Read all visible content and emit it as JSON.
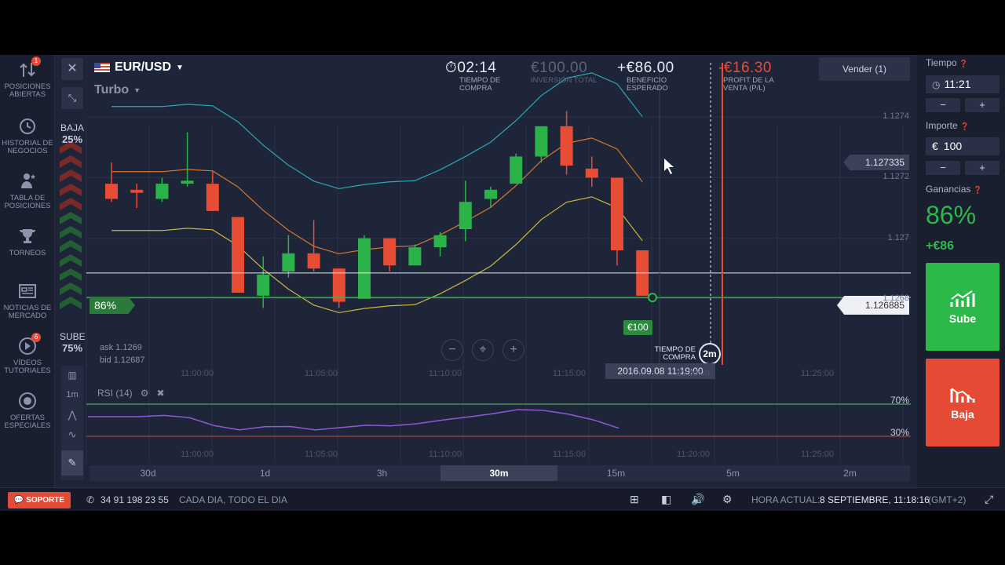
{
  "sidebar": {
    "items": [
      {
        "label_l1": "POSICIONES",
        "label_l2": "ABIERTAS",
        "icon": "positions-icon",
        "badge": "1"
      },
      {
        "label_l1": "HISTORIAL DE",
        "label_l2": "NEGOCIOS",
        "icon": "history-icon"
      },
      {
        "label_l1": "TABLA DE",
        "label_l2": "POSICIONES",
        "icon": "leaderboard-icon"
      },
      {
        "label_l1": "TORNEOS",
        "label_l2": "",
        "icon": "trophy-icon"
      },
      {
        "label_l1": "NOTICIAS DE",
        "label_l2": "MERCADO",
        "icon": "news-icon"
      },
      {
        "label_l1": "VÍDEOS",
        "label_l2": "TUTORIALES",
        "icon": "video-icon",
        "badge": "6"
      },
      {
        "label_l1": "OFERTAS",
        "label_l2": "ESPECIALES",
        "icon": "offers-icon"
      }
    ]
  },
  "header": {
    "pair": "EUR/USD",
    "mode": "Turbo",
    "timer": {
      "value": "02:14",
      "label_l1": "TIEMPO DE",
      "label_l2": "COMPRA"
    },
    "investment": {
      "value": "€100.00",
      "label": "INVERSIÓN TOTAL"
    },
    "profit": {
      "value": "+€86.00",
      "label_l1": "BENEFICIO",
      "label_l2": "ESPERADO"
    },
    "pl": {
      "value": "-€16.30",
      "label_l1": "PROFIT DE LA",
      "label_l2": "VENTA (P/L)"
    },
    "sell_button": "Vender (1)"
  },
  "sentiment": {
    "down_label": "BAJA",
    "down_pct": "25%",
    "up_label": "SUBE",
    "up_pct": "75%"
  },
  "chart": {
    "payout_tag": "86%",
    "price_tag_top": "1.127335",
    "price_tag_current": "1.126885",
    "price_levels": [
      "1.1274",
      "1.1272",
      "1.127",
      "1.1268"
    ],
    "ask": "ask 1.1269",
    "bid": "bid 1.12687",
    "bet_tag": "€100",
    "expiry_label_l1": "TIEMPO DE",
    "expiry_label_l2": "COMPRA",
    "expiry_badge": "2m",
    "cursor_time": "2016.09.08 11:19:00",
    "time_ticks": [
      "11:00:00",
      "11:05:00",
      "11:10:00",
      "11:15:00",
      "11:20:00",
      "11:25:00"
    ],
    "indicator": "RSI (14)",
    "rsi_levels": [
      "70%",
      "30%"
    ],
    "timeframes": [
      "30d",
      "1d",
      "3h",
      "30m",
      "15m",
      "5m",
      "2m"
    ],
    "active_timeframe": "30m",
    "candle_interval": "1m"
  },
  "chart_data": {
    "type": "candlestick",
    "x_axis": [
      "11:00:00",
      "11:05:00",
      "11:10:00",
      "11:15:00",
      "11:20:00",
      "11:25:00"
    ],
    "y_axis_ticks": [
      1.1274,
      1.1272,
      1.127,
      1.1268
    ],
    "candles": [
      {
        "o": 1.12718,
        "c": 1.12713,
        "h": 1.12725,
        "l": 1.12712,
        "dir": "down"
      },
      {
        "o": 1.12716,
        "c": 1.12715,
        "h": 1.12718,
        "l": 1.1271,
        "dir": "down"
      },
      {
        "o": 1.12713,
        "c": 1.12718,
        "h": 1.1272,
        "l": 1.12712,
        "dir": "up"
      },
      {
        "o": 1.12718,
        "c": 1.12719,
        "h": 1.12735,
        "l": 1.12717,
        "dir": "up"
      },
      {
        "o": 1.12718,
        "c": 1.12709,
        "h": 1.12722,
        "l": 1.12709,
        "dir": "down"
      },
      {
        "o": 1.12707,
        "c": 1.12682,
        "h": 1.12707,
        "l": 1.12682,
        "dir": "down"
      },
      {
        "o": 1.12681,
        "c": 1.12688,
        "h": 1.12694,
        "l": 1.12677,
        "dir": "up"
      },
      {
        "o": 1.12689,
        "c": 1.12695,
        "h": 1.12701,
        "l": 1.12687,
        "dir": "up"
      },
      {
        "o": 1.12695,
        "c": 1.1269,
        "h": 1.12706,
        "l": 1.12689,
        "dir": "down"
      },
      {
        "o": 1.1269,
        "c": 1.12679,
        "h": 1.1269,
        "l": 1.12677,
        "dir": "down"
      },
      {
        "o": 1.1268,
        "c": 1.127,
        "h": 1.12701,
        "l": 1.1268,
        "dir": "up"
      },
      {
        "o": 1.127,
        "c": 1.12691,
        "h": 1.127,
        "l": 1.12689,
        "dir": "down"
      },
      {
        "o": 1.12691,
        "c": 1.12697,
        "h": 1.12698,
        "l": 1.12691,
        "dir": "up"
      },
      {
        "o": 1.12697,
        "c": 1.12701,
        "h": 1.12702,
        "l": 1.12694,
        "dir": "up"
      },
      {
        "o": 1.12703,
        "c": 1.12712,
        "h": 1.12719,
        "l": 1.12699,
        "dir": "up"
      },
      {
        "o": 1.12713,
        "c": 1.12716,
        "h": 1.12717,
        "l": 1.1271,
        "dir": "up"
      },
      {
        "o": 1.12718,
        "c": 1.12727,
        "h": 1.12728,
        "l": 1.12718,
        "dir": "up"
      },
      {
        "o": 1.12727,
        "c": 1.12737,
        "h": 1.12737,
        "l": 1.12725,
        "dir": "up"
      },
      {
        "o": 1.12737,
        "c": 1.12724,
        "h": 1.12742,
        "l": 1.12721,
        "dir": "down"
      },
      {
        "o": 1.12723,
        "c": 1.1272,
        "h": 1.12727,
        "l": 1.12717,
        "dir": "down"
      },
      {
        "o": 1.1272,
        "c": 1.12696,
        "h": 1.1272,
        "l": 1.12691,
        "dir": "down"
      },
      {
        "o": 1.12696,
        "c": 1.12681,
        "h": 1.12696,
        "l": 1.12681,
        "dir": "down"
      }
    ],
    "current_price": 1.126885,
    "strike_price": 1.12683,
    "rsi_levels": [
      70,
      30
    ]
  },
  "right_panel": {
    "time_label": "Tiempo",
    "time_value": "11:21",
    "amount_label": "Importe",
    "currency": "€",
    "amount_value": "100",
    "minus": "−",
    "plus": "+",
    "gain_label": "Ganancias",
    "gain_pct": "86%",
    "gain_value": "+€86",
    "up_button": "Sube",
    "down_button": "Baja"
  },
  "footer": {
    "support": "SOPORTE",
    "phone": "34 91 198 23 55",
    "hours": "CADA DIA, TODO EL DIA",
    "time_label": "HORA ACTUAL:",
    "time_value": "8 SEPTIEMBRE, 11:18:16",
    "tz": "(GMT+2)"
  },
  "colors": {
    "up": "#2bb34a",
    "down": "#e74c34",
    "accent_green": "#2db84a",
    "bg": "#1f2538"
  }
}
